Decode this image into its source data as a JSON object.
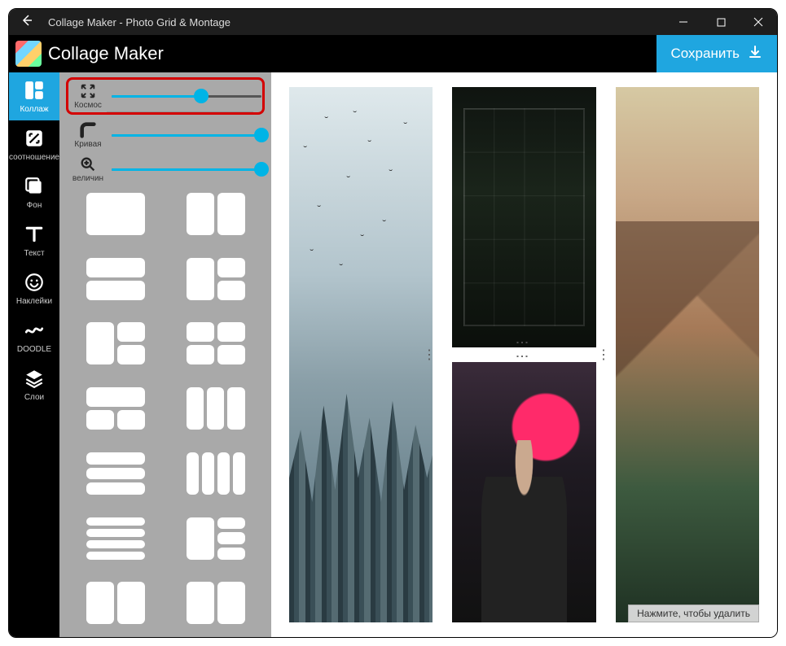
{
  "window": {
    "title": "Collage Maker - Photo Grid & Montage"
  },
  "logo": {
    "text": "Collage Maker"
  },
  "save": {
    "label": "Сохранить"
  },
  "sidebar": {
    "items": [
      {
        "label": "Коллаж"
      },
      {
        "label": "соотношение"
      },
      {
        "label": "Фон"
      },
      {
        "label": "Текст"
      },
      {
        "label": "Наклейки"
      },
      {
        "label": "DOODLE"
      },
      {
        "label": "Слои"
      }
    ]
  },
  "sliders": {
    "space": {
      "label": "Космос",
      "value": 60
    },
    "curve": {
      "label": "Кривая",
      "value": 100
    },
    "zoom": {
      "label": "величин",
      "value": 100
    }
  },
  "hint": {
    "text": "Нажмите, чтобы удалить"
  }
}
